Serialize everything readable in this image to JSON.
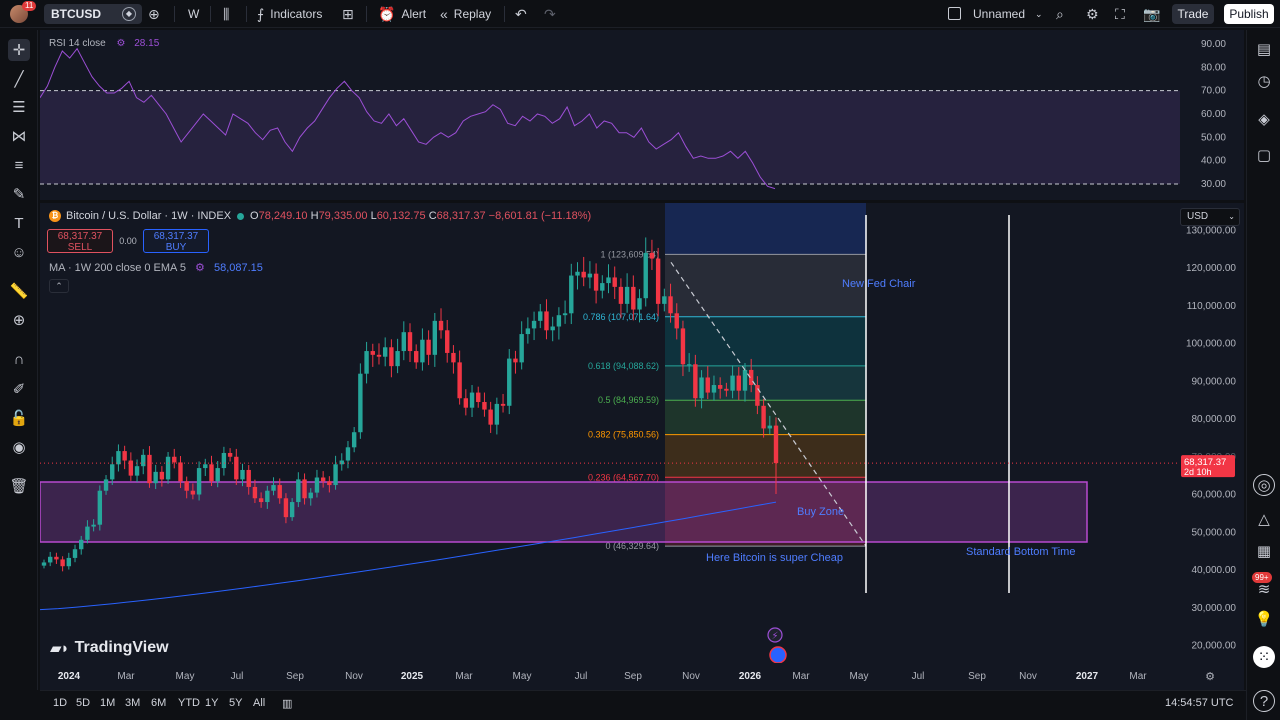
{
  "topbar": {
    "avatar_badge": "11",
    "symbol": "BTCUSD",
    "interval": "W",
    "indicators_label": "Indicators",
    "alert_label": "Alert",
    "replay_label": "Replay",
    "layout_name": "Unnamed",
    "trade_label": "Trade",
    "publish_label": "Publish"
  },
  "rsi": {
    "legend_label": "RSI 14 close",
    "value": "28.15",
    "levels": [
      "90.00",
      "80.00",
      "70.00",
      "60.00",
      "50.00",
      "40.00",
      "30.00"
    ],
    "values": [
      67,
      72,
      80,
      87,
      84,
      88,
      82,
      76,
      72,
      69,
      69,
      71,
      74,
      67,
      65,
      68,
      64,
      60,
      54,
      48,
      52,
      56,
      60,
      57,
      54,
      51,
      60,
      58,
      56,
      52,
      49,
      53,
      54,
      48,
      44,
      50,
      54,
      57,
      62,
      67,
      71,
      74,
      70,
      67,
      61,
      57,
      56,
      60,
      55,
      58,
      53,
      48,
      47,
      50,
      52,
      50,
      52,
      57,
      59,
      60,
      61,
      64,
      62,
      56,
      55,
      59,
      57,
      60,
      59,
      56,
      58,
      63,
      55,
      57,
      60,
      54,
      57,
      56,
      52,
      52,
      50,
      54,
      48,
      45,
      47,
      49,
      52,
      46,
      41,
      42,
      41,
      41,
      42,
      44,
      41,
      44,
      39,
      33,
      29,
      28
    ]
  },
  "main": {
    "title": "Bitcoin / U.S. Dollar · 1W · INDEX",
    "ohlc": {
      "o_label": "O",
      "o": "78,249.10",
      "h_label": "H",
      "h": "79,335.00",
      "l_label": "L",
      "l": "60,132.75",
      "c_label": "C",
      "c": "68,317.37",
      "change": "−8,601.81 (−11.18%)"
    },
    "sell_price": "68,317.37",
    "sell_label": "SELL",
    "spread": "0.00",
    "buy_price": "68,317.37",
    "buy_label": "BUY",
    "ma_label": "MA · 1W 200 close 0 EMA 5",
    "ma_value": "58,087.15",
    "currency": "USD",
    "last_price": "68,317.37",
    "last_countdown": "2d 10h",
    "price_levels": [
      "130,000.00",
      "120,000.00",
      "110,000.00",
      "100,000.00",
      "90,000.00",
      "80,000.00",
      "70,000.00",
      "60,000.00",
      "50,000.00",
      "40,000.00",
      "30,000.00",
      "20,000.00"
    ],
    "time_labels": [
      "2024",
      "Mar",
      "May",
      "Jul",
      "Sep",
      "Nov",
      "2025",
      "Mar",
      "May",
      "Jul",
      "Sep",
      "Nov",
      "2026",
      "Mar",
      "May",
      "Jul",
      "Sep",
      "Nov",
      "2027",
      "Mar"
    ],
    "fib_labels": [
      "1 (123,609.54)",
      "0.786 (107,071.64)",
      "0.618 (94,088.62)",
      "0.5 (84,969.59)",
      "0.382 (75,850.56)",
      "0.236 (64,567.70)",
      "0 (46,329.64)"
    ],
    "annotations": {
      "fed": "New Fed Chair",
      "buy_zone": "Buy Zone",
      "cheap": "Here Bitcoin is super Cheap",
      "bottom": "Standard Bottom Time"
    },
    "closes": [
      42000,
      43500,
      42800,
      41000,
      43200,
      45500,
      48000,
      51500,
      52000,
      61000,
      64000,
      68000,
      71500,
      69000,
      65000,
      67500,
      70500,
      63000,
      66000,
      64000,
      70000,
      68500,
      63500,
      61000,
      60000,
      67000,
      68000,
      63500,
      67000,
      71000,
      70000,
      64000,
      66500,
      62000,
      59000,
      58000,
      61000,
      62500,
      59000,
      54000,
      58000,
      64000,
      59000,
      60500,
      64500,
      63500,
      62500,
      68000,
      69000,
      72500,
      76500,
      92000,
      98000,
      97000,
      96500,
      99000,
      94000,
      98000,
      103000,
      98000,
      95000,
      101000,
      97000,
      106000,
      103500,
      97500,
      95000,
      85500,
      83000,
      87000,
      84500,
      82500,
      78500,
      84000,
      83500,
      96000,
      95000,
      102500,
      104000,
      106000,
      108500,
      103500,
      104500,
      107500,
      108000,
      118000,
      119000,
      117500,
      118500,
      114000,
      116000,
      117500,
      115000,
      110500,
      115000,
      109000,
      112000,
      124000,
      122500,
      110500,
      112500,
      108000,
      104000,
      94500,
      94500,
      85500,
      91000,
      87000,
      89000,
      88000,
      87500,
      91500,
      87500,
      93000,
      89000,
      83500,
      77500,
      78249,
      68317
    ]
  },
  "bottom": {
    "ranges": [
      "1D",
      "5D",
      "1M",
      "3M",
      "6M",
      "YTD",
      "1Y",
      "5Y",
      "All"
    ],
    "time": "14:54:57 UTC"
  },
  "brand": {
    "logo_text": "TradingView"
  },
  "colors": {
    "up": "#26a69a",
    "down": "#f23645",
    "rsi_line": "#9c4fd6",
    "ma_line": "#2962ff",
    "buy_zone": "#b84ad0"
  }
}
